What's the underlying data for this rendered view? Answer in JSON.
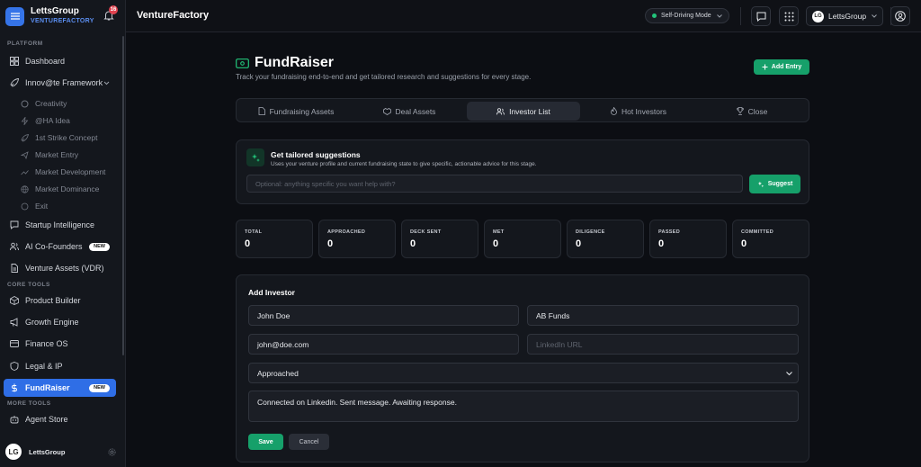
{
  "sidebar": {
    "brand_name": "LettsGroup",
    "brand_sub": "VENTUREFACTORY",
    "notif_count": "16",
    "sections": {
      "platform": "PLATFORM",
      "core": "CORE TOOLS",
      "more": "MORE TOOLS"
    },
    "items": {
      "dashboard": "Dashboard",
      "innovate": "Innov@te Framework",
      "startup": "Startup Intelligence",
      "cofounders": "AI Co-Founders",
      "assets": "Venture Assets (VDR)",
      "product": "Product Builder",
      "growth": "Growth Engine",
      "finance": "Finance OS",
      "legal": "Legal & IP",
      "fundraiser": "FundRaiser",
      "agent": "Agent Store"
    },
    "subitems": {
      "creativity": "Creativity",
      "ha": "@HA Idea",
      "strike": "1st Strike Concept",
      "market_entry": "Market Entry",
      "market_dev": "Market Development",
      "market_dom": "Market Dominance",
      "exit": "Exit"
    },
    "badge_new": "NEW",
    "user_name": "LettsGroup",
    "avatar_text": "LG"
  },
  "topbar": {
    "title": "VentureFactory",
    "mode_label": "Self-Driving Mode",
    "workspace": "LettsGroup"
  },
  "page": {
    "title": "FundRaiser",
    "subtitle": "Track your fundraising end-to-end and get tailored research and suggestions for every stage.",
    "add_entry": "Add Entry"
  },
  "tabs": {
    "fundraising": "Fundraising Assets",
    "deal": "Deal Assets",
    "investor": "Investor List",
    "hot": "Hot Investors",
    "close": "Close"
  },
  "suggest": {
    "title": "Get tailored suggestions",
    "desc": "Uses your venture profile and current fundraising state to give specific, actionable advice for this stage.",
    "placeholder": "Optional: anything specific you want help with?",
    "button": "Suggest"
  },
  "stats": [
    {
      "label": "TOTAL",
      "value": "0"
    },
    {
      "label": "APPROACHED",
      "value": "0"
    },
    {
      "label": "DECK SENT",
      "value": "0"
    },
    {
      "label": "MET",
      "value": "0"
    },
    {
      "label": "DILIGENCE",
      "value": "0"
    },
    {
      "label": "PASSED",
      "value": "0"
    },
    {
      "label": "COMMITTED",
      "value": "0"
    }
  ],
  "form": {
    "title": "Add Investor",
    "name": "John Doe",
    "firm": "AB Funds",
    "email": "john@doe.com",
    "linkedin_placeholder": "LinkedIn URL",
    "status": "Approached",
    "notes": "Connected on Linkedin. Sent message. Awaiting response.",
    "save": "Save",
    "cancel": "Cancel"
  },
  "colors": {
    "accent": "#2f6ee6",
    "success": "#16a06a",
    "background": "#0c0e13"
  }
}
